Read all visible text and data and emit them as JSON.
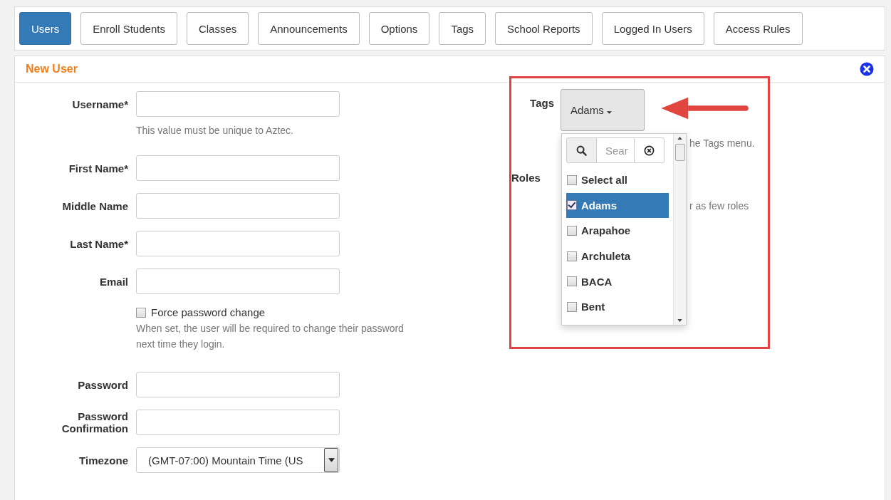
{
  "tabs": [
    {
      "label": "Users",
      "selected": true
    },
    {
      "label": "Enroll Students",
      "selected": false
    },
    {
      "label": "Classes",
      "selected": false
    },
    {
      "label": "Announcements",
      "selected": false
    },
    {
      "label": "Options",
      "selected": false
    },
    {
      "label": "Tags",
      "selected": false
    },
    {
      "label": "School Reports",
      "selected": false
    },
    {
      "label": "Logged In Users",
      "selected": false
    },
    {
      "label": "Access Rules",
      "selected": false
    }
  ],
  "panel": {
    "title": "New User"
  },
  "fields": [
    {
      "kind": "text",
      "label": "Username*",
      "help": "This value must be unique to Aztec."
    },
    {
      "kind": "text",
      "label": "First Name*"
    },
    {
      "kind": "text",
      "label": "Middle Name"
    },
    {
      "kind": "text",
      "label": "Last Name*"
    },
    {
      "kind": "text",
      "label": "Email"
    },
    {
      "kind": "checkbox",
      "label": "Force password change",
      "checked": false,
      "help": "When set, the user will be required to change their password next time they login."
    },
    {
      "kind": "text",
      "label": "Password"
    },
    {
      "kind": "text",
      "label": "Password Confirmation"
    },
    {
      "kind": "select",
      "label": "Timezone",
      "value": "(GMT-07:00) Mountain Time (US"
    }
  ],
  "tags": {
    "label": "Tags",
    "button": "Adams",
    "help": "he Tags menu.",
    "search_placeholder": "Sear",
    "options": [
      {
        "label": "Select all",
        "checked": false,
        "selected": false
      },
      {
        "label": "Adams",
        "checked": true,
        "selected": true
      },
      {
        "label": "Arapahoe",
        "checked": false,
        "selected": false
      },
      {
        "label": "Archuleta",
        "checked": false,
        "selected": false
      },
      {
        "label": "BACA",
        "checked": false,
        "selected": false
      },
      {
        "label": "Bent",
        "checked": false,
        "selected": false
      }
    ]
  },
  "roles": {
    "label": "Roles",
    "help": "r as few roles"
  }
}
